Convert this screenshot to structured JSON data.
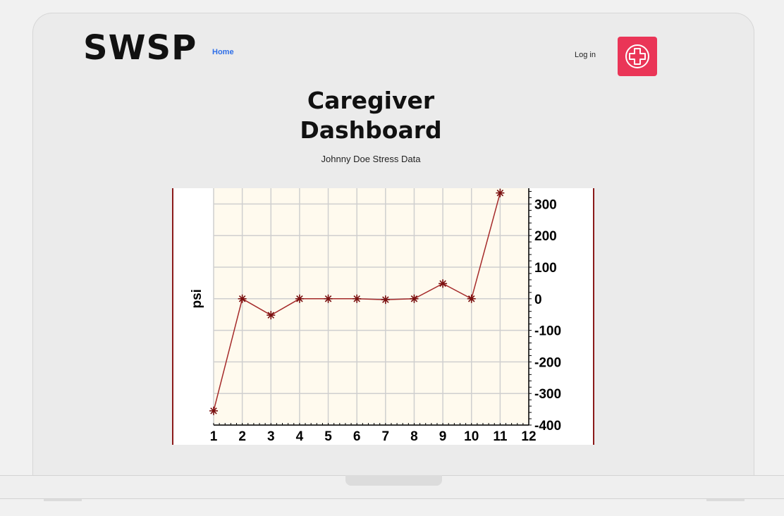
{
  "header": {
    "logo": "SWSP",
    "nav_home": "Home",
    "login": "Log in",
    "cross_icon": "medical-cross-icon",
    "accent_color": "#ea3557"
  },
  "main": {
    "title": "Caregiver Dashboard",
    "subtitle": "Johnny Doe Stress Data"
  },
  "chart_data": {
    "type": "line",
    "ylabel": "psi",
    "xlabel": "",
    "x": [
      1,
      2,
      3,
      4,
      5,
      6,
      7,
      8,
      9,
      10,
      11
    ],
    "series": [
      {
        "values": [
          -355,
          0,
          -52,
          0,
          0,
          0,
          -3,
          0,
          48,
          0,
          335
        ]
      }
    ],
    "xlim": [
      1,
      12
    ],
    "ylim": [
      -400,
      350
    ],
    "x_ticks": [
      1,
      2,
      3,
      4,
      5,
      6,
      7,
      8,
      9,
      10,
      11,
      12
    ],
    "y_ticks": [
      300,
      200,
      100,
      0,
      -100,
      -200,
      -300,
      -400
    ],
    "grid": true,
    "line_color": "#a52a2a",
    "plot_bg": "#fffaee"
  }
}
